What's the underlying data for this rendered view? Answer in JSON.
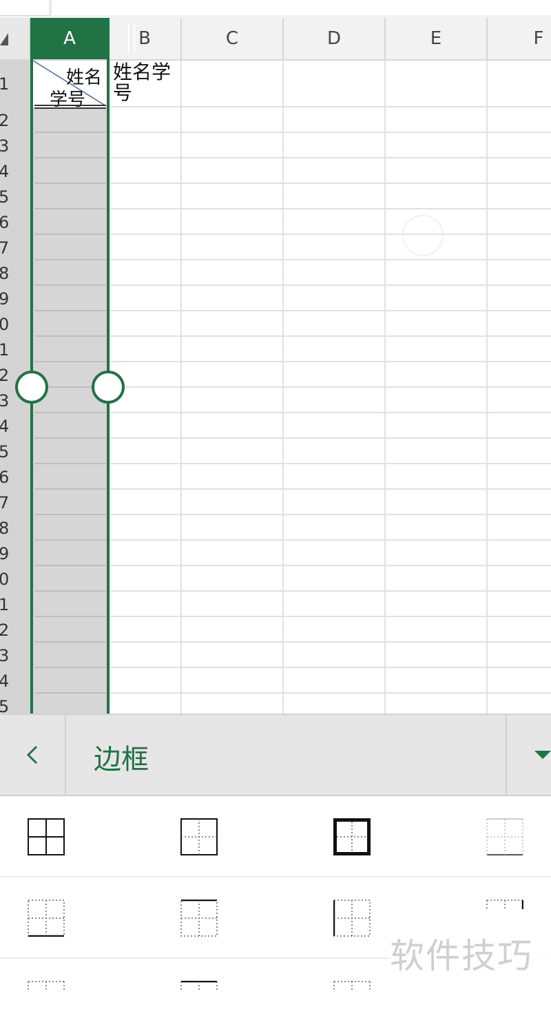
{
  "sheet": {
    "columns": [
      "A",
      "B",
      "C",
      "D",
      "E",
      "F"
    ],
    "selected_column": "A",
    "row_labels": [
      "1",
      "2",
      "3",
      "4",
      "5",
      "6",
      "7",
      "8",
      "9",
      "0",
      "1",
      "2",
      "3",
      "4",
      "5",
      "6",
      "7",
      "8",
      "9",
      "0",
      "1",
      "2",
      "3",
      "4",
      "5"
    ],
    "cell_a1": {
      "top_text": "姓名",
      "bottom_text": "学号"
    },
    "cell_b1": {
      "text": "姓名学号"
    }
  },
  "panel": {
    "back_icon": "chevron-left-icon",
    "title": "边框",
    "dropdown_icon": "caret-down-icon",
    "accent_color": "#217346",
    "options": [
      {
        "name": "all-borders-icon"
      },
      {
        "name": "outside-borders-dotted-inside-icon"
      },
      {
        "name": "thick-outside-borders-icon"
      },
      {
        "name": "light-dotted-borders-icon"
      },
      {
        "name": "bottom-border-dotted-icon"
      },
      {
        "name": "top-bottom-borders-icon"
      },
      {
        "name": "left-border-dotted-icon"
      },
      {
        "name": "right-border-dotted-icon"
      },
      {
        "name": "border-option-icon"
      },
      {
        "name": "border-option-icon"
      },
      {
        "name": "border-option-icon"
      }
    ]
  },
  "watermark": {
    "text": "软件技巧"
  }
}
